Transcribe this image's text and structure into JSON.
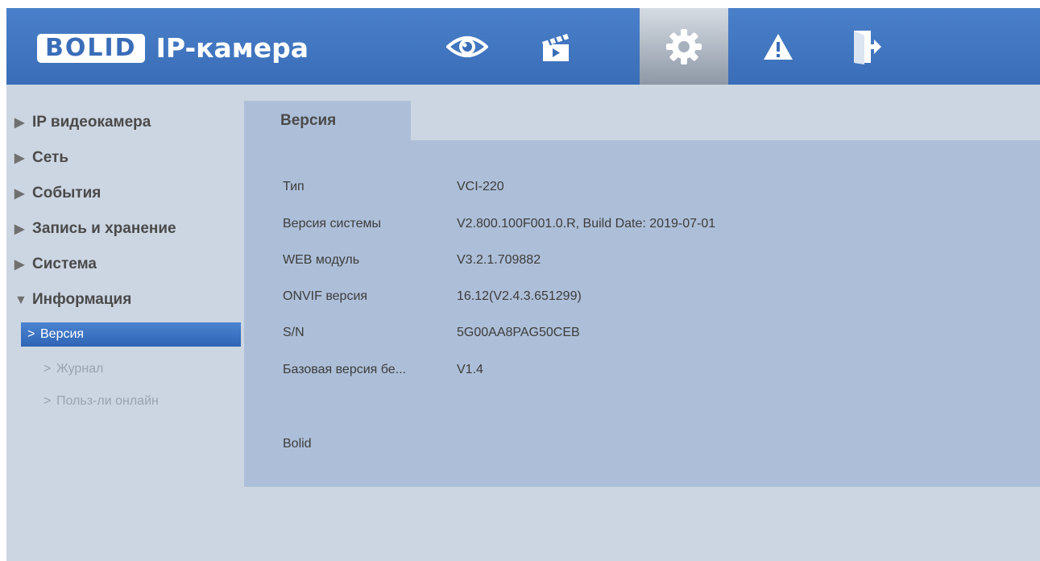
{
  "header": {
    "logo_text": "BOLID",
    "app_title": "IP-камера",
    "nav": [
      {
        "icon": "eye-icon"
      },
      {
        "icon": "clapperboard-icon"
      },
      {
        "icon": "gear-icon",
        "active": true
      },
      {
        "icon": "warning-icon"
      },
      {
        "icon": "logout-icon"
      }
    ]
  },
  "sidebar": {
    "items": [
      {
        "label": "IP видеокамера",
        "expanded": false
      },
      {
        "label": "Сеть",
        "expanded": false
      },
      {
        "label": "События",
        "expanded": false
      },
      {
        "label": "Запись и хранение",
        "expanded": false
      },
      {
        "label": "Система",
        "expanded": false
      },
      {
        "label": "Информация",
        "expanded": true
      }
    ],
    "subitems": [
      {
        "label": "Версия",
        "active": true
      },
      {
        "label": "Журнал",
        "active": false
      },
      {
        "label": "Польз-ли онлайн",
        "active": false
      }
    ]
  },
  "main": {
    "tab_label": "Версия",
    "info_rows": [
      {
        "label": "Тип",
        "value": "VCI-220"
      },
      {
        "label": "Версия системы",
        "value": "V2.800.100F001.0.R, Build Date: 2019-07-01"
      },
      {
        "label": "WEB модуль",
        "value": "V3.2.1.709882"
      },
      {
        "label": "ONVIF версия",
        "value": "16.12(V2.4.3.651299)"
      },
      {
        "label": "S/N",
        "value": "5G00AA8PAG50CEB"
      },
      {
        "label": "Базовая версия бе...",
        "value": "V1.4"
      }
    ],
    "vendor": "Bolid"
  },
  "colors": {
    "header_blue": "#3a6db8",
    "panel": "#adbfd8",
    "background": "#ccd6e2",
    "active_item": "#2e64b5"
  }
}
